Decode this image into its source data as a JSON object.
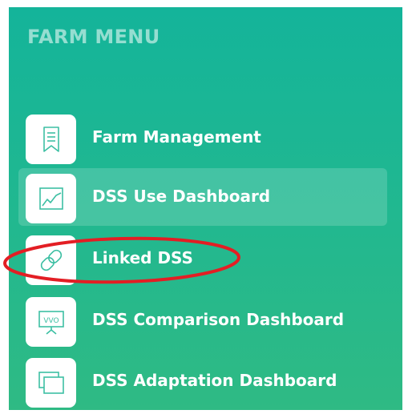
{
  "menu": {
    "title": "FARM MENU",
    "items": [
      {
        "label": "Farm Management",
        "icon": "bookmark-document-icon",
        "active": false
      },
      {
        "label": "DSS Use Dashboard",
        "icon": "line-chart-icon",
        "active": true
      },
      {
        "label": "Linked DSS",
        "icon": "link-icon",
        "active": false
      },
      {
        "label": "DSS Comparison Dashboard",
        "icon": "whiteboard-vs-icon",
        "active": false
      },
      {
        "label": "DSS Adaptation Dashboard",
        "icon": "stacked-windows-icon",
        "active": false
      }
    ]
  },
  "annotation": {
    "target": "Linked DSS",
    "color": "#e31e24"
  },
  "colors": {
    "sidebar_top": "#14b49a",
    "sidebar_bottom": "#2fba84",
    "icon_stroke": "#3dbfa3",
    "label": "#ffffff"
  },
  "icon_text": {
    "whiteboard": "VVO"
  }
}
